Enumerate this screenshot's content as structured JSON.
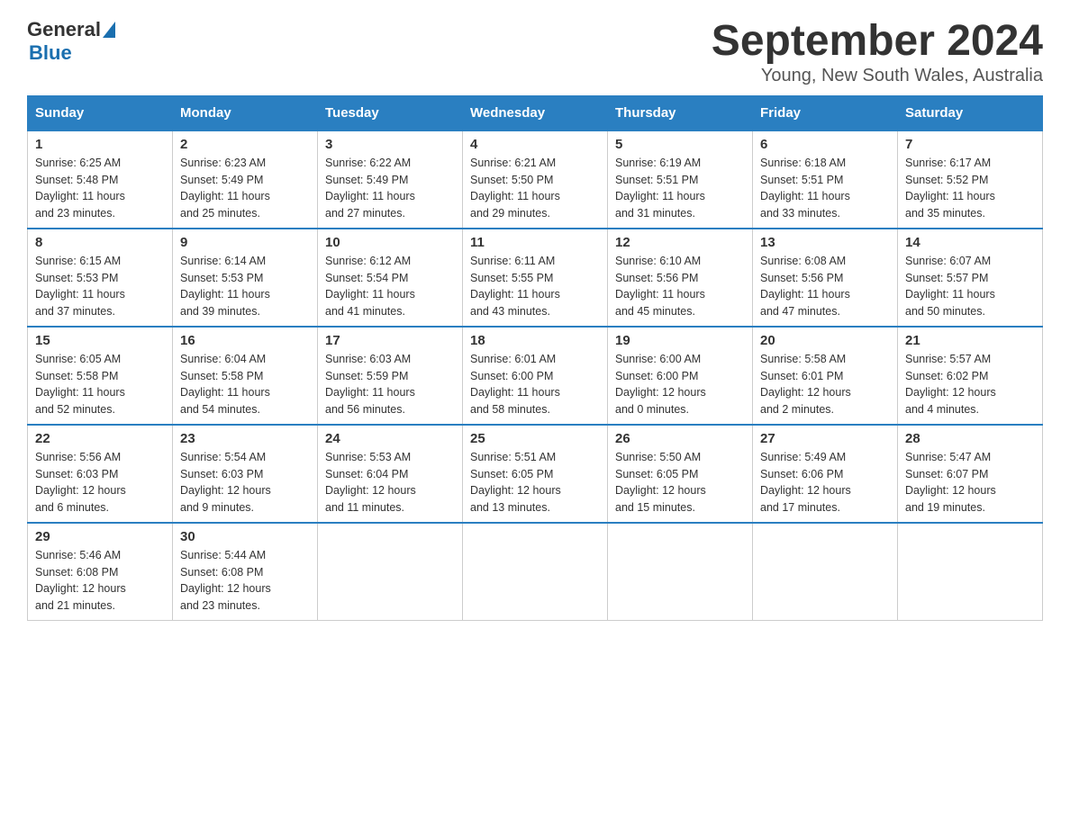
{
  "header": {
    "logo": {
      "text_general": "General",
      "text_blue": "Blue"
    },
    "title": "September 2024",
    "subtitle": "Young, New South Wales, Australia"
  },
  "days_of_week": [
    "Sunday",
    "Monday",
    "Tuesday",
    "Wednesday",
    "Thursday",
    "Friday",
    "Saturday"
  ],
  "weeks": [
    [
      {
        "day": "1",
        "sunrise": "6:25 AM",
        "sunset": "5:48 PM",
        "daylight": "11 hours and 23 minutes."
      },
      {
        "day": "2",
        "sunrise": "6:23 AM",
        "sunset": "5:49 PM",
        "daylight": "11 hours and 25 minutes."
      },
      {
        "day": "3",
        "sunrise": "6:22 AM",
        "sunset": "5:49 PM",
        "daylight": "11 hours and 27 minutes."
      },
      {
        "day": "4",
        "sunrise": "6:21 AM",
        "sunset": "5:50 PM",
        "daylight": "11 hours and 29 minutes."
      },
      {
        "day": "5",
        "sunrise": "6:19 AM",
        "sunset": "5:51 PM",
        "daylight": "11 hours and 31 minutes."
      },
      {
        "day": "6",
        "sunrise": "6:18 AM",
        "sunset": "5:51 PM",
        "daylight": "11 hours and 33 minutes."
      },
      {
        "day": "7",
        "sunrise": "6:17 AM",
        "sunset": "5:52 PM",
        "daylight": "11 hours and 35 minutes."
      }
    ],
    [
      {
        "day": "8",
        "sunrise": "6:15 AM",
        "sunset": "5:53 PM",
        "daylight": "11 hours and 37 minutes."
      },
      {
        "day": "9",
        "sunrise": "6:14 AM",
        "sunset": "5:53 PM",
        "daylight": "11 hours and 39 minutes."
      },
      {
        "day": "10",
        "sunrise": "6:12 AM",
        "sunset": "5:54 PM",
        "daylight": "11 hours and 41 minutes."
      },
      {
        "day": "11",
        "sunrise": "6:11 AM",
        "sunset": "5:55 PM",
        "daylight": "11 hours and 43 minutes."
      },
      {
        "day": "12",
        "sunrise": "6:10 AM",
        "sunset": "5:56 PM",
        "daylight": "11 hours and 45 minutes."
      },
      {
        "day": "13",
        "sunrise": "6:08 AM",
        "sunset": "5:56 PM",
        "daylight": "11 hours and 47 minutes."
      },
      {
        "day": "14",
        "sunrise": "6:07 AM",
        "sunset": "5:57 PM",
        "daylight": "11 hours and 50 minutes."
      }
    ],
    [
      {
        "day": "15",
        "sunrise": "6:05 AM",
        "sunset": "5:58 PM",
        "daylight": "11 hours and 52 minutes."
      },
      {
        "day": "16",
        "sunrise": "6:04 AM",
        "sunset": "5:58 PM",
        "daylight": "11 hours and 54 minutes."
      },
      {
        "day": "17",
        "sunrise": "6:03 AM",
        "sunset": "5:59 PM",
        "daylight": "11 hours and 56 minutes."
      },
      {
        "day": "18",
        "sunrise": "6:01 AM",
        "sunset": "6:00 PM",
        "daylight": "11 hours and 58 minutes."
      },
      {
        "day": "19",
        "sunrise": "6:00 AM",
        "sunset": "6:00 PM",
        "daylight": "12 hours and 0 minutes."
      },
      {
        "day": "20",
        "sunrise": "5:58 AM",
        "sunset": "6:01 PM",
        "daylight": "12 hours and 2 minutes."
      },
      {
        "day": "21",
        "sunrise": "5:57 AM",
        "sunset": "6:02 PM",
        "daylight": "12 hours and 4 minutes."
      }
    ],
    [
      {
        "day": "22",
        "sunrise": "5:56 AM",
        "sunset": "6:03 PM",
        "daylight": "12 hours and 6 minutes."
      },
      {
        "day": "23",
        "sunrise": "5:54 AM",
        "sunset": "6:03 PM",
        "daylight": "12 hours and 9 minutes."
      },
      {
        "day": "24",
        "sunrise": "5:53 AM",
        "sunset": "6:04 PM",
        "daylight": "12 hours and 11 minutes."
      },
      {
        "day": "25",
        "sunrise": "5:51 AM",
        "sunset": "6:05 PM",
        "daylight": "12 hours and 13 minutes."
      },
      {
        "day": "26",
        "sunrise": "5:50 AM",
        "sunset": "6:05 PM",
        "daylight": "12 hours and 15 minutes."
      },
      {
        "day": "27",
        "sunrise": "5:49 AM",
        "sunset": "6:06 PM",
        "daylight": "12 hours and 17 minutes."
      },
      {
        "day": "28",
        "sunrise": "5:47 AM",
        "sunset": "6:07 PM",
        "daylight": "12 hours and 19 minutes."
      }
    ],
    [
      {
        "day": "29",
        "sunrise": "5:46 AM",
        "sunset": "6:08 PM",
        "daylight": "12 hours and 21 minutes."
      },
      {
        "day": "30",
        "sunrise": "5:44 AM",
        "sunset": "6:08 PM",
        "daylight": "12 hours and 23 minutes."
      },
      null,
      null,
      null,
      null,
      null
    ]
  ],
  "labels": {
    "sunrise": "Sunrise:",
    "sunset": "Sunset:",
    "daylight": "Daylight:"
  }
}
